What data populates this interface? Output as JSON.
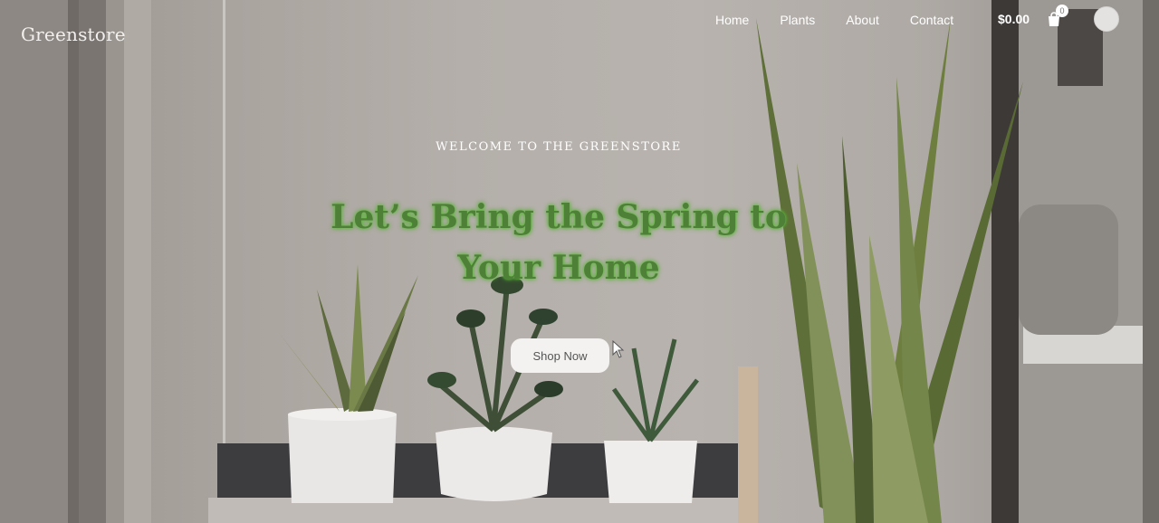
{
  "header": {
    "logo": "Greenstore",
    "nav": [
      {
        "label": "Home"
      },
      {
        "label": "Plants"
      },
      {
        "label": "About"
      },
      {
        "label": "Contact"
      }
    ],
    "cart_total": "$0.00",
    "cart_count": "0",
    "cart_icon": "shopping-bag-icon",
    "avatar_icon": "user-avatar-icon"
  },
  "hero": {
    "eyebrow": "WELCOME TO THE GREENSTORE",
    "headline": "Let’s Bring the Spring to Your Home",
    "cta_label": "Shop Now"
  },
  "colors": {
    "headline_green": "#4f8038",
    "glow_green": "#63c53d",
    "button_bg": "#f3f2f1"
  }
}
